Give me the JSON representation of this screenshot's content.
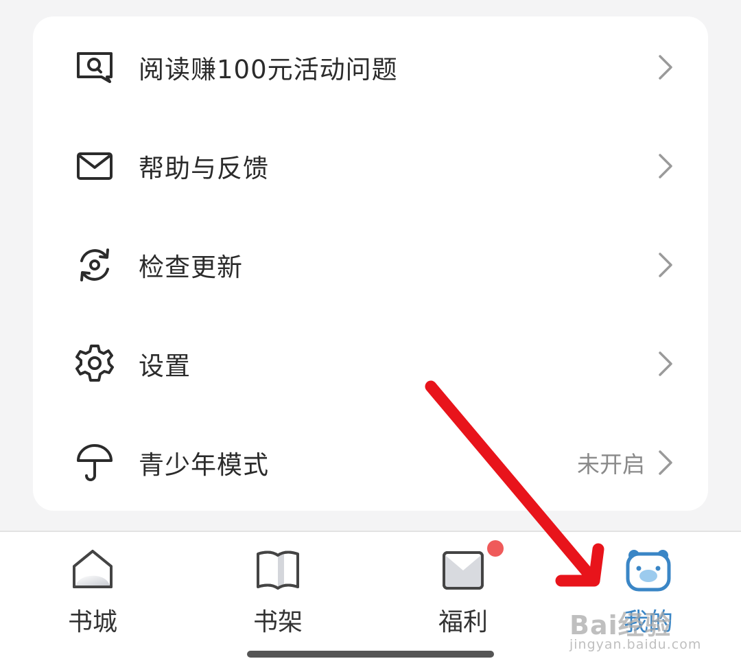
{
  "menu": {
    "items": [
      {
        "label": "阅读赚100元活动问题",
        "icon": "feedback-chat-icon",
        "value": ""
      },
      {
        "label": "帮助与反馈",
        "icon": "mail-icon",
        "value": ""
      },
      {
        "label": "检查更新",
        "icon": "refresh-update-icon",
        "value": ""
      },
      {
        "label": "设置",
        "icon": "gear-icon",
        "value": ""
      },
      {
        "label": "青少年模式",
        "icon": "umbrella-icon",
        "value": "未开启"
      }
    ]
  },
  "tabs": [
    {
      "label": "书城",
      "icon": "home-icon",
      "active": false,
      "badge": false
    },
    {
      "label": "书架",
      "icon": "book-icon",
      "active": false,
      "badge": false
    },
    {
      "label": "福利",
      "icon": "gift-envelope-icon",
      "active": false,
      "badge": true
    },
    {
      "label": "我的",
      "icon": "bear-face-icon",
      "active": true,
      "badge": false
    }
  ],
  "watermark": {
    "main": "Bai经验",
    "sub": "jingyan.baidu.com"
  },
  "colors": {
    "accent": "#3a86c6",
    "badge": "#ef5a5a",
    "arrow": "#e8141b"
  }
}
